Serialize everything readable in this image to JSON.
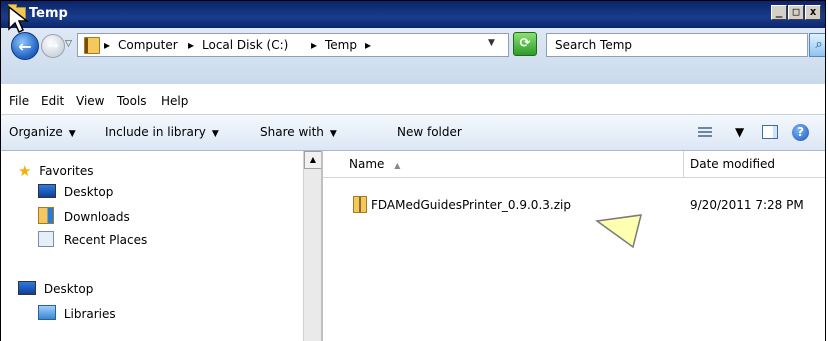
{
  "window": {
    "title": "Temp"
  },
  "titlebar_buttons": {
    "minimize": "_",
    "maximize": "□",
    "close": "x"
  },
  "address": {
    "crumbs": [
      "Computer",
      "Local Disk (C:)",
      "Temp"
    ],
    "separator": "▸"
  },
  "search": {
    "placeholder": "Search Temp"
  },
  "menu": [
    "File",
    "Edit",
    "View",
    "Tools",
    "Help"
  ],
  "commands": {
    "organize": "Organize",
    "include": "Include in library",
    "share": "Share with",
    "new_folder": "New folder"
  },
  "nav": {
    "favorites": "Favorites",
    "desktop": "Desktop",
    "downloads": "Downloads",
    "recent": "Recent Places",
    "desktop2": "Desktop",
    "libraries": "Libraries"
  },
  "columns": {
    "name": "Name",
    "date": "Date modified"
  },
  "files": [
    {
      "name": "FDAMedGuidesPrinter_0.9.0.3.zip",
      "date": "9/20/2011 7:28 PM"
    }
  ],
  "colors": {
    "titlebar": "#0a246a",
    "accent": "#1e5fc0",
    "callout": "#ffffb0"
  },
  "icons": {
    "back": "back-arrow-icon",
    "forward": "forward-arrow-icon",
    "refresh": "refresh-icon",
    "search": "search-icon",
    "help": "help-icon"
  }
}
